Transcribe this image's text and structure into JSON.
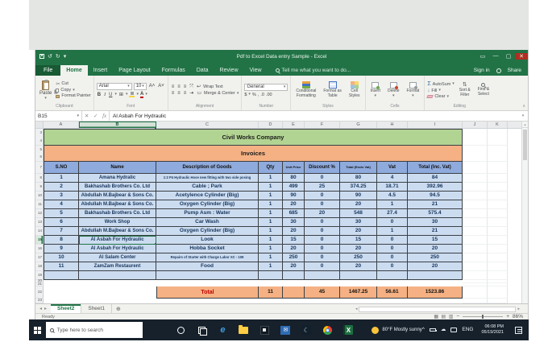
{
  "titlebar": {
    "title": "Pdf to Excel Data entry Sample - Excel"
  },
  "menu": {
    "tabs": [
      "File",
      "Home",
      "Insert",
      "Page Layout",
      "Formulas",
      "Data",
      "Review",
      "View"
    ],
    "active_tab": "Home",
    "tellme": "Tell me what you want to do...",
    "signin": "Sign in",
    "share": "Share"
  },
  "ribbon": {
    "clipboard": {
      "label": "Clipboard",
      "paste": "Paste",
      "cut": "Cut",
      "copy": "Copy",
      "format_painter": "Format Painter"
    },
    "font": {
      "label": "Font",
      "name": "Arial",
      "size": "10"
    },
    "alignment": {
      "label": "Alignment",
      "wrap": "Wrap Text",
      "merge": "Merge & Center"
    },
    "number": {
      "label": "Number",
      "format": "General"
    },
    "styles": {
      "label": "Styles",
      "conditional_1": "Conditional",
      "conditional_2": "Formatting",
      "format_table_1": "Format as",
      "format_table_2": "Table",
      "cell_styles_1": "Cell",
      "cell_styles_2": "Styles"
    },
    "cells": {
      "label": "Cells",
      "insert": "Insert",
      "delete": "Delete",
      "format": "Format"
    },
    "editing": {
      "label": "Editing",
      "autosum": "AutoSum",
      "fill": "Fill",
      "clear": "Clear",
      "sort_1": "Sort &",
      "sort_2": "Filter",
      "find_1": "Find &",
      "find_2": "Select"
    }
  },
  "formula_bar": {
    "name_box": "B15",
    "value": "Al Asbah For Hydraulic"
  },
  "sheet": {
    "col_letters": [
      "A",
      "B",
      "C",
      "D",
      "E",
      "F",
      "G",
      "H",
      "I",
      "J",
      "K"
    ],
    "selected_cell": "B15",
    "title": "Civil Works Company",
    "subtitle": "Invoices",
    "headers": [
      "S.NO",
      "Name",
      "Description of Goods",
      "Qty",
      "Unit Price",
      "Discount %",
      "Total (Excls Vat)",
      "Vat",
      "Total (Inc. Vat)"
    ],
    "rows": [
      [
        "1",
        "Amana Hydralic",
        "1:2 P4 Hydraulic Hose new fitting with two side posing",
        "1",
        "80",
        "0",
        "80",
        "4",
        "84"
      ],
      [
        "2",
        "Bakhashab Brothers Co. Ltd",
        "Cable ; Park",
        "1",
        "499",
        "25",
        "374.25",
        "18.71",
        "392.96"
      ],
      [
        "3",
        "Abdullah M.Bajbear & Sons Co.",
        "Acetylence Cylinder (Big)",
        "1",
        "90",
        "0",
        "90",
        "4.5",
        "94.5"
      ],
      [
        "4",
        "Abdullah M.Bajbear & Sons Co.",
        "Oxygen Cylinder (Big)",
        "1",
        "20",
        "0",
        "20",
        "1",
        "21"
      ],
      [
        "5",
        "Bakhashab Brothers Co. Ltd",
        "Pump Asm : Water",
        "1",
        "685",
        "20",
        "548",
        "27.4",
        "575.4"
      ],
      [
        "6",
        "Work Shop",
        "Car Wash",
        "1",
        "30",
        "0",
        "30",
        "0",
        "30"
      ],
      [
        "7",
        "Abdullah M.Bajbear & Sons Co.",
        "Oxygen Cylinder (Big)",
        "1",
        "20",
        "0",
        "20",
        "1",
        "21"
      ],
      [
        "8",
        "Al Asbah For Hydraulic",
        "Look",
        "1",
        "15",
        "0",
        "15",
        "0",
        "15"
      ],
      [
        "9",
        "Al Asbah For Hydraulic",
        "Hobba Socket",
        "1",
        "20",
        "0",
        "20",
        "0",
        "20"
      ],
      [
        "10",
        "Al Salam Center",
        "Repairs of Starter with Charge Labor  XC - 109",
        "1",
        "250",
        "0",
        "250",
        "0",
        "250"
      ],
      [
        "11",
        "ZamZam Restaurent",
        "Food",
        "1",
        "20",
        "0",
        "20",
        "0",
        "20"
      ]
    ],
    "total_row": {
      "label": "Total",
      "qty": "11",
      "unit_price": "",
      "discount": "45",
      "total_excl": "1467.25",
      "vat": "56.61",
      "total_inc": "1523.86"
    }
  },
  "sheet_tabs": {
    "tabs": [
      {
        "label": "Sheet2",
        "active": true
      },
      {
        "label": "Sheet1",
        "active": false
      }
    ]
  },
  "status_bar": {
    "mode": "Ready",
    "zoom": "86%"
  },
  "taskbar": {
    "search_placeholder": "Type here to search",
    "icons": [
      "cortana",
      "task-view",
      "edge",
      "file-explorer",
      "photos",
      "mail",
      "skype",
      "chrome",
      "excel"
    ],
    "weather": "80°F Mostly sunny",
    "language": "ENG",
    "time": "06:08 PM",
    "date": "05/19/2021"
  }
}
